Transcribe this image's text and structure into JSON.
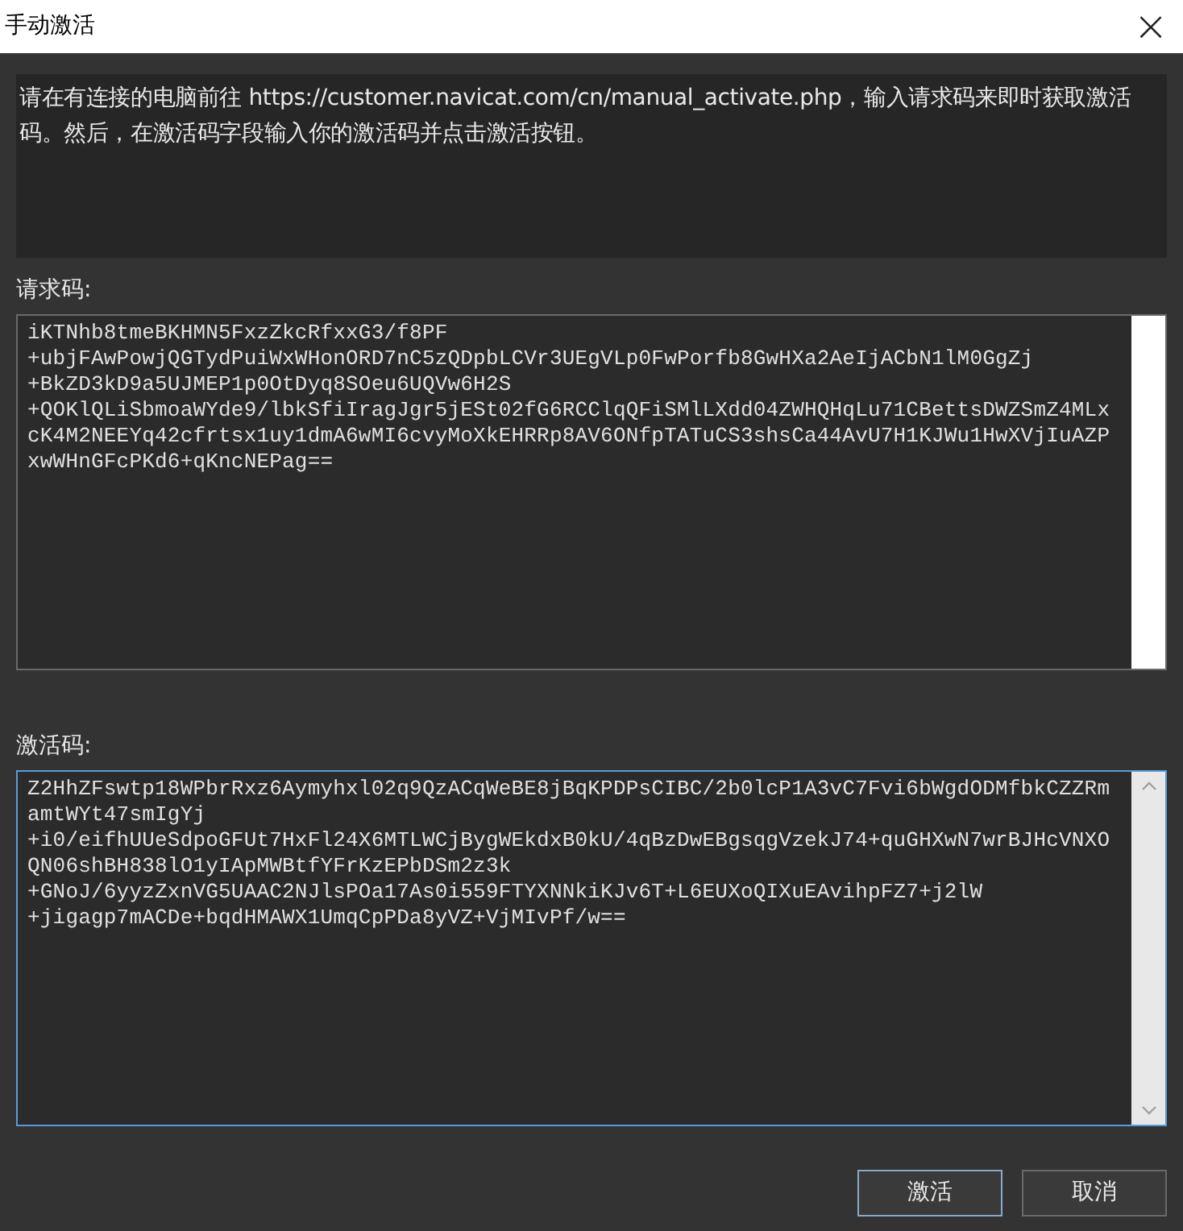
{
  "window": {
    "title": "手动激活",
    "close": "×"
  },
  "description": "请在有连接的电脑前往 https://customer.navicat.com/cn/manual_activate.php，输入请求码来即时获取激活码。然后，在激活码字段输入你的激活码并点击激活按钮。",
  "request_code": {
    "label": "请求码:",
    "lines": [
      "iKTNhb8tmeBKHMN5FxzZkcRfxxG3/f8PF",
      "+ubjFAwPowjQGTydPuiWxWHonORD7nC5zQDpbLCVr3UEgVLp0FwPorfb8GwHXa2AeIjACbN1lM0GgZj",
      "+BkZD3kD9a5UJMEP1p0OtDyq8SOeu6UQVw6H2S",
      "+QOKlQLiSbmoaWYde9/lbkSfiIragJgr5jESt02fG6RCClqQFiSMlLXdd04ZWHQHqLu71CBettsDWZSmZ4MLx",
      "cK4M2NEEYq42cfrtsx1uy1dmA6wMI6cvyMoXkEHRRp8AV6ONfpTATuCS3shsCa44AvU7H1KJWu1HwXVjIuAZP",
      "xwWHnGFcPKd6+qKncNEPag=="
    ]
  },
  "activation_code": {
    "label": "激活码:",
    "focused": true,
    "lines": [
      "Z2HhZFswtp18WPbrRxz6Aymyhxl02q9QzACqWeBE8jBqKPDPsCIBC/2b0lcP1A3vC7Fvi6bWgdODMfbkCZZRm",
      "amtWYt47smIgYj",
      "+i0/eifhUUeSdpoGFUt7HxFl24X6MTLWCjBygWEkdxB0kU/4qBzDwEBgsqgVzekJ74+quGHXwN7wrBJHcVNXO",
      "QN06shBH838lO1yIApMWBtfYFrKzEPbDSm2z3k",
      "+GNoJ/6yyzZxnVG5UAAC2NJlsPOa17As0i559FTYXNNkiKJv6T+L6EUXoQIXuEAvihpFZ7+j2lW",
      "+jigagp7mACDe+bqdHMAWX1UmqCpPDa8yVZ+VjMIvPf/w=="
    ]
  },
  "buttons": [
    {
      "label": "激活",
      "selected": true
    },
    {
      "label": "取消",
      "selected": false
    }
  ]
}
